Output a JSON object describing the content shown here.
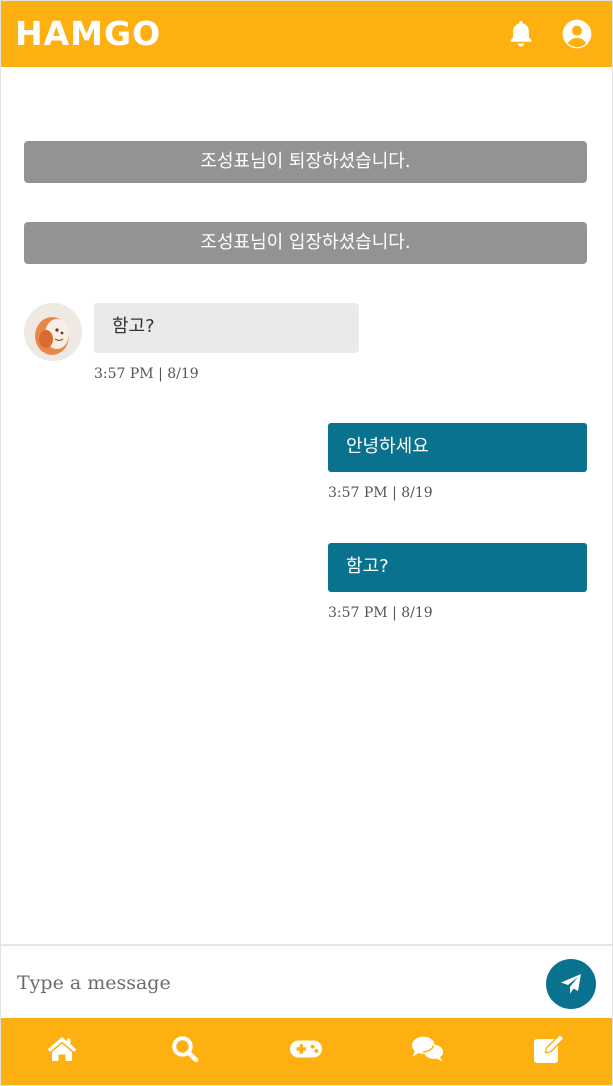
{
  "header": {
    "logo": "HAMGO",
    "icons": {
      "notifications": "bell-icon",
      "profile": "user-circle-icon"
    },
    "color": "#fdb00f"
  },
  "chat": {
    "system_messages": [
      "조성표님이 퇴장하셨습니다.",
      "조성표님이 입장하셨습니다."
    ],
    "messages": [
      {
        "direction": "incoming",
        "text": "함고?",
        "time": "3:57 PM | 8/19"
      },
      {
        "direction": "outgoing",
        "text": "안녕하세요",
        "time": "3:57 PM | 8/19"
      },
      {
        "direction": "outgoing",
        "text": "함고?",
        "time": "3:57 PM | 8/19"
      }
    ],
    "colors": {
      "outgoing_bubble": "#08728f",
      "incoming_bubble": "#eaeaea",
      "system_notice": "#939393"
    }
  },
  "composer": {
    "placeholder": "Type a message",
    "send_icon": "paper-plane-icon"
  },
  "bottom_nav": {
    "items": [
      "home-icon",
      "search-icon",
      "gamepad-icon",
      "chat-bubbles-icon",
      "edit-icon"
    ]
  }
}
